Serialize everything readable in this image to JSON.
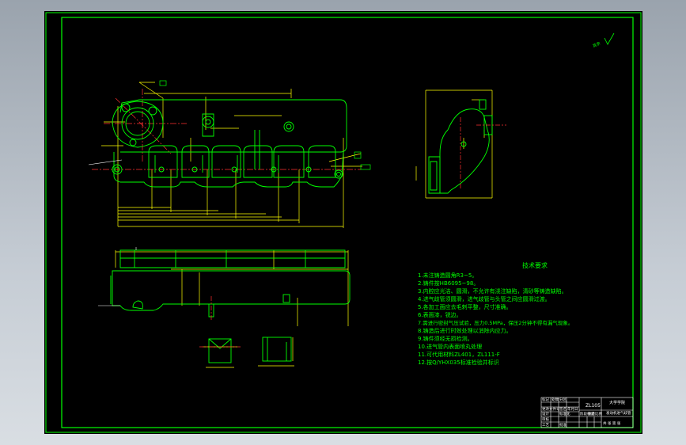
{
  "tech_req": {
    "title": "技术要求",
    "items": [
      "1.未注铸造圆角R3~5。",
      "2.铸件按HB6095~98。",
      "3.内腔应光洁、圆滑，不允许有浇注缺陷，清砂等铸造缺陷。",
      "4.进气歧管须圆滑，进气歧管与头管之间应圆滑过渡。",
      "5.各加工面应去毛刺平整，尺寸准确。",
      "6.表面漆，锐边。",
      "7.需进行密封气压试验，压力0.5MPa，保压2分钟不得有漏气现象。",
      "8.铸造后进行时效处理以消除内应力。",
      "9.铸件须经无损检测。",
      "10.进气管内表面喷丸处理",
      "11.可代用材料ZL401，ZL111-F",
      "12.按Q/YHX035标准检验并标识"
    ]
  },
  "title_block": {
    "material": "ZL105",
    "company": "大学学院",
    "drawing_name": "发动机进气歧管",
    "labels": [
      "标记",
      "处数",
      "分区",
      "更改文件号",
      "签名",
      "年月日"
    ],
    "role_labels": [
      "设计",
      "标准化",
      "审核",
      "工艺",
      "批准"
    ],
    "meta_labels": [
      "阶段标记",
      "重量",
      "比例"
    ],
    "sheet_info": "共 张 第 张"
  },
  "roughness_note": "其余"
}
